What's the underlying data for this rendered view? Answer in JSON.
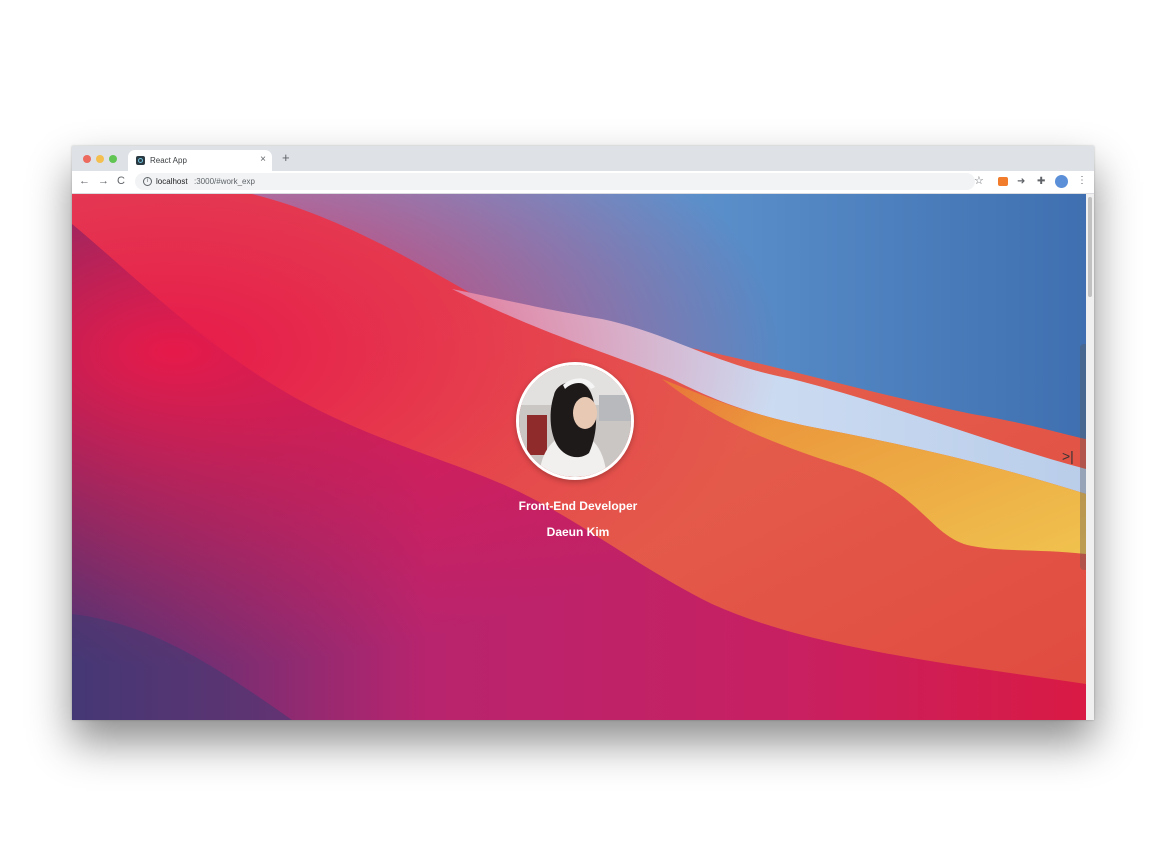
{
  "browser": {
    "tab": {
      "title": "React App",
      "close": "×"
    },
    "new_tab": "+",
    "nav": {
      "back": "←",
      "forward": "→",
      "reload": "C"
    },
    "address": {
      "host": "localhost",
      "rest": ":3000/#work_exp",
      "info": "i"
    },
    "star": "☆",
    "extensions": [
      "ext-orange",
      "ext-dash",
      "puzzle-icon"
    ],
    "menu": "⋮"
  },
  "page": {
    "role": "Front-End Developer",
    "name": "Daeun Kim",
    "side_toggle": ">|"
  },
  "colors": {
    "red": "#e23a4b",
    "blue": "#4f86c6",
    "orange": "#ec9a3a",
    "purple": "#5a2f7a"
  }
}
